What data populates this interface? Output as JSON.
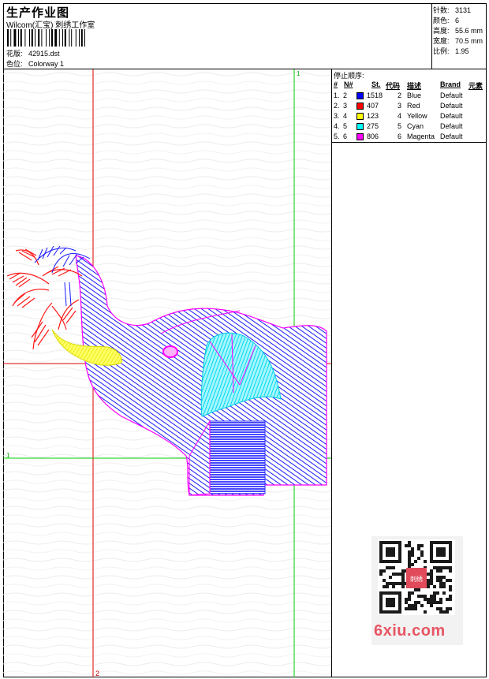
{
  "header": {
    "title": "生产作业图",
    "studio": "Wilcom(汇宝) 刺绣工作室",
    "design_label": "花版:",
    "design_value": "42915.dst",
    "colorway_label": "色位:",
    "colorway_value": "Colorway 1"
  },
  "stats": {
    "stitches_label": "针数:",
    "stitches_value": "3131",
    "colors_label": "颜色:",
    "colors_value": "6",
    "height_label": "高度:",
    "height_value": "55.6 mm",
    "width_label": "宽度:",
    "width_value": "70.5 mm",
    "scale_label": "比例:",
    "scale_value": "1.95"
  },
  "legend": {
    "title": "停止顺序:",
    "headers": {
      "num": "#",
      "n": "N#",
      "st": "St.",
      "code": "代码",
      "desc": "描述",
      "brand": "Brand",
      "element": "元素"
    },
    "rows": [
      {
        "num": "1.",
        "n": "2",
        "st": "1518",
        "code": "2",
        "desc": "Blue",
        "brand": "Default",
        "color": "#0000ff"
      },
      {
        "num": "2.",
        "n": "3",
        "st": "407",
        "code": "3",
        "desc": "Red",
        "brand": "Default",
        "color": "#ff0000"
      },
      {
        "num": "3.",
        "n": "4",
        "st": "123",
        "code": "4",
        "desc": "Yellow",
        "brand": "Default",
        "color": "#ffff00"
      },
      {
        "num": "4.",
        "n": "5",
        "st": "275",
        "code": "5",
        "desc": "Cyan",
        "brand": "Default",
        "color": "#00ffff"
      },
      {
        "num": "5.",
        "n": "6",
        "st": "806",
        "code": "6",
        "desc": "Magenta",
        "brand": "Default",
        "color": "#ff00ff"
      }
    ]
  },
  "guides": {
    "green_v_label": "1",
    "green_h_label": "1",
    "red_v_label": "2",
    "green_color": "#00cc00",
    "red_color": "#dd0000"
  },
  "watermark": {
    "brand_text": "6xiu.com",
    "seal_text": "刺绣",
    "brand_color": "#e85563"
  }
}
